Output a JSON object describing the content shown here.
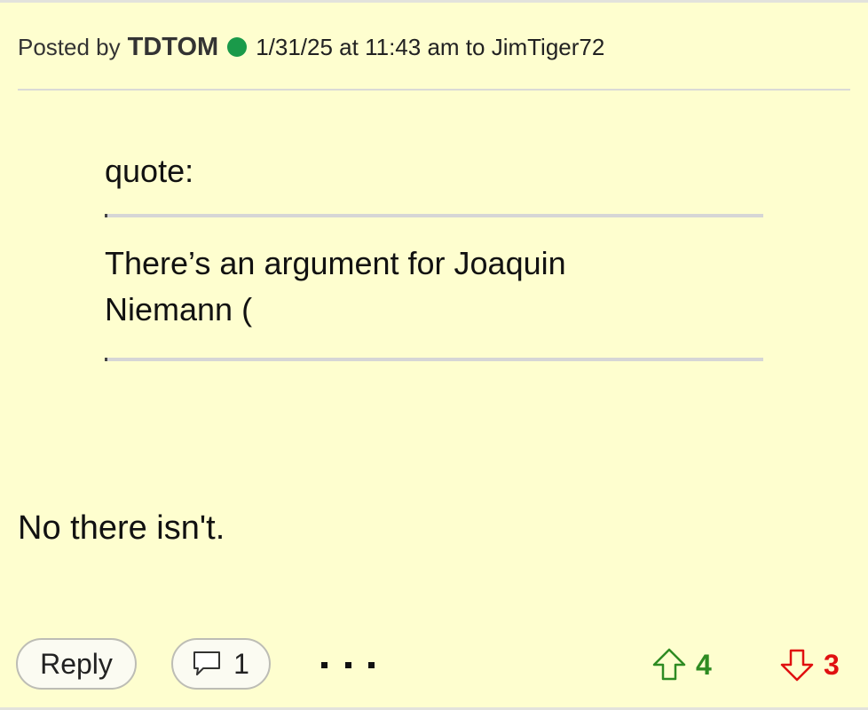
{
  "post": {
    "posted_by_label": "Posted by",
    "username": "TDTOM",
    "online_status_color": "#1a9a4a",
    "timestamp_text": "1/31/25 at 11:43 am to JimTiger72"
  },
  "quote": {
    "label": "quote:",
    "text": "There’s an argument for Joaquin Niemann ("
  },
  "body": {
    "text": "No there isn't."
  },
  "actions": {
    "reply_label": "Reply",
    "comment_count": "1",
    "upvotes": "4",
    "downvotes": "3",
    "upvote_color": "#2e8b22",
    "downvote_color": "#e01010"
  }
}
